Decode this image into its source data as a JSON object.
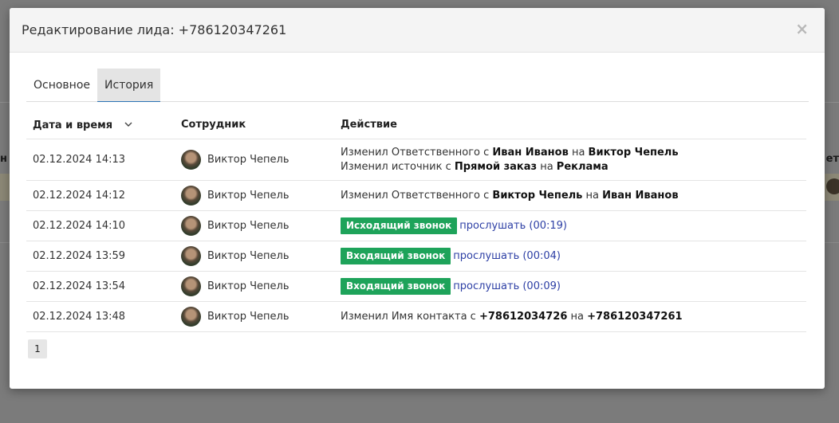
{
  "modal": {
    "title": "Редактирование лида: +786120347261",
    "close": "×"
  },
  "tabs": [
    {
      "label": "Основное",
      "active": false
    },
    {
      "label": "История",
      "active": true
    }
  ],
  "table": {
    "headers": {
      "date": "Дата и время",
      "employee": "Сотрудник",
      "action": "Действие"
    },
    "rows": [
      {
        "date": "02.12.2024 14:13",
        "employee": "Виктор Чепель",
        "lines": [
          [
            {
              "t": "Изменил Ответственного с "
            },
            {
              "t": "Иван Иванов",
              "b": true
            },
            {
              "t": " на "
            },
            {
              "t": "Виктор Чепель",
              "b": true
            }
          ],
          [
            {
              "t": "Изменил источник с "
            },
            {
              "t": "Прямой заказ",
              "b": true
            },
            {
              "t": " на "
            },
            {
              "t": "Реклама",
              "b": true
            }
          ]
        ]
      },
      {
        "date": "02.12.2024 14:12",
        "employee": "Виктор Чепель",
        "lines": [
          [
            {
              "t": "Изменил Ответственного с "
            },
            {
              "t": "Виктор Чепель",
              "b": true
            },
            {
              "t": " на "
            },
            {
              "t": "Иван Иванов",
              "b": true
            }
          ]
        ]
      },
      {
        "date": "02.12.2024 14:10",
        "employee": "Виктор Чепель",
        "badge": "Исходящий звонок",
        "listen": "прослушать (00:19)"
      },
      {
        "date": "02.12.2024 13:59",
        "employee": "Виктор Чепель",
        "badge": "Входящий звонок",
        "listen": "прослушать (00:04)"
      },
      {
        "date": "02.12.2024 13:54",
        "employee": "Виктор Чепель",
        "badge": "Входящий звонок",
        "listen": "прослушать (00:09)"
      },
      {
        "date": "02.12.2024 13:48",
        "employee": "Виктор Чепель",
        "lines": [
          [
            {
              "t": "Изменил Имя контакта с "
            },
            {
              "t": "+78612034726",
              "b": true
            },
            {
              "t": " на "
            },
            {
              "t": "+786120347261",
              "b": true
            }
          ]
        ]
      }
    ]
  },
  "pagination": {
    "pages": [
      "1"
    ],
    "current": "1"
  },
  "colors": {
    "badge": "#1ea35a",
    "link": "#2d3fa5",
    "tab_underline": "#2b73b5"
  },
  "icons": {
    "sort": "chevron-down-icon",
    "close": "close-icon"
  },
  "background": {
    "left_fragment": "н",
    "right_fragment": "ет"
  }
}
